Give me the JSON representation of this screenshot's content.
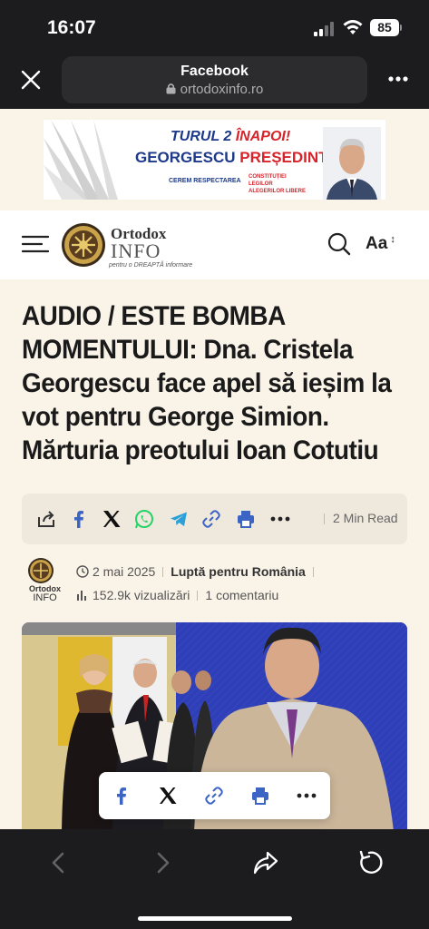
{
  "status_bar": {
    "time": "16:07",
    "battery": "85"
  },
  "browser": {
    "title": "Facebook",
    "domain": "ortodoxinfo.ro"
  },
  "ad": {
    "line1_a": "TURUL 2 ",
    "line1_b": "ÎNAPOI!",
    "line2_a": "GEORGESCU ",
    "line2_b": "PREȘEDINTE!",
    "small1": "CEREM RESPECTAREA",
    "small2_1": "CONSTITUȚIEI",
    "small2_2": "LEGILOR",
    "small2_3": "ALEGERILOR LIBERE"
  },
  "site": {
    "logo_line1": "Ortodox",
    "logo_line2": "INFO",
    "logo_tag": "pentru o DREAPTĂ informare",
    "font_size_button": "Aa"
  },
  "article": {
    "headline": "AUDIO / ESTE BOMBA MOMENTULUI: Dna. Cristela Georgescu face apel să ieșim la vot pentru George Simion. Mărturia preotului Ioan Cotutiu",
    "read_time": "2 Min Read",
    "date": "2 mai 2025",
    "category": "Luptă pentru România",
    "views": "152.9k vizualizări",
    "comments": "1 comentariu",
    "author_logo_1": "Ortodox",
    "author_logo_2": "INFO"
  },
  "share_icons": [
    "share-icon",
    "facebook-icon",
    "x-icon",
    "whatsapp-icon",
    "telegram-icon",
    "link-icon",
    "print-icon",
    "more-icon"
  ],
  "colors": {
    "facebook": "#3b64c4",
    "whatsapp": "#25d366",
    "telegram": "#2a9fd8",
    "link": "#3b64c4",
    "print": "#3b64c4",
    "ad_blue": "#1d3a8a",
    "ad_red": "#d8232a"
  }
}
